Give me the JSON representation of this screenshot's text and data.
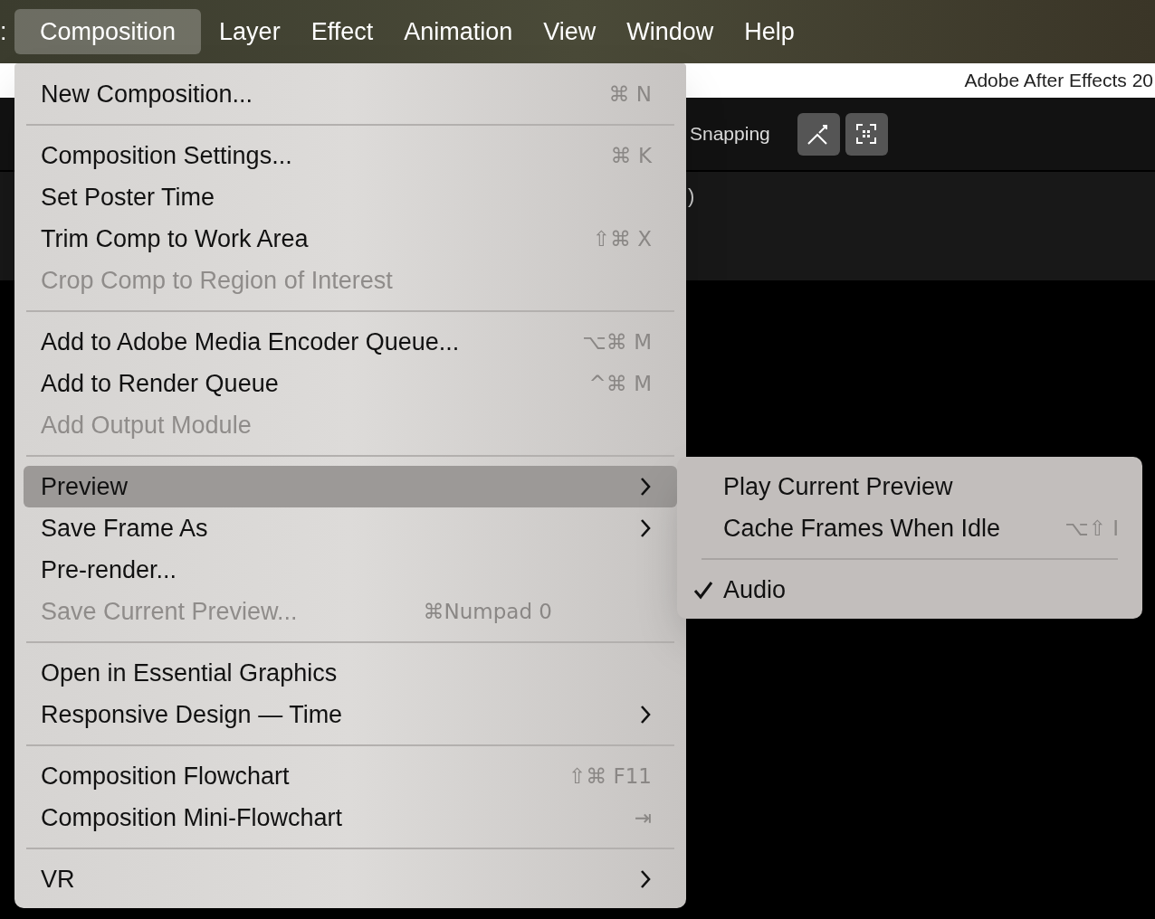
{
  "menubar": {
    "cut_item": ":",
    "items": [
      {
        "label": "Composition",
        "selected": true
      },
      {
        "label": "Layer",
        "selected": false
      },
      {
        "label": "Effect",
        "selected": false
      },
      {
        "label": "Animation",
        "selected": false
      },
      {
        "label": "View",
        "selected": false
      },
      {
        "label": "Window",
        "selected": false
      },
      {
        "label": "Help",
        "selected": false
      }
    ]
  },
  "app_window": {
    "title": "Adobe After Effects 20",
    "toolbar": {
      "snapping_label": "Snapping"
    },
    "panel_text": ")"
  },
  "menu": {
    "items": [
      {
        "kind": "item",
        "label": "New Composition...",
        "shortcut": "⌘ N",
        "disabled": false,
        "submenu": false,
        "selected": false
      },
      {
        "kind": "separator"
      },
      {
        "kind": "item",
        "label": "Composition Settings...",
        "shortcut": "⌘ K",
        "disabled": false,
        "submenu": false,
        "selected": false
      },
      {
        "kind": "item",
        "label": "Set Poster Time",
        "disabled": false,
        "submenu": false,
        "selected": false
      },
      {
        "kind": "item",
        "label": "Trim Comp to Work Area",
        "shortcut": "⇧⌘ X",
        "disabled": false,
        "submenu": false,
        "selected": false
      },
      {
        "kind": "item",
        "label": "Crop Comp to Region of Interest",
        "disabled": true,
        "submenu": false,
        "selected": false
      },
      {
        "kind": "separator"
      },
      {
        "kind": "item",
        "label": "Add to Adobe Media Encoder Queue...",
        "shortcut": "⌥⌘ M",
        "disabled": false,
        "submenu": false,
        "selected": false
      },
      {
        "kind": "item",
        "label": "Add to Render Queue",
        "shortcut": "^⌘ M",
        "disabled": false,
        "submenu": false,
        "selected": false
      },
      {
        "kind": "item",
        "label": "Add Output Module",
        "disabled": true,
        "submenu": false,
        "selected": false
      },
      {
        "kind": "separator"
      },
      {
        "kind": "item",
        "label": "Preview",
        "disabled": false,
        "submenu": true,
        "selected": true
      },
      {
        "kind": "item",
        "label": "Save Frame As",
        "disabled": false,
        "submenu": true,
        "selected": false
      },
      {
        "kind": "item",
        "label": "Pre-render...",
        "disabled": false,
        "submenu": false,
        "selected": false
      },
      {
        "kind": "item",
        "label": "Save Current Preview...",
        "shortcut": "⌘Numpad 0",
        "disabled": true,
        "submenu": false,
        "selected": false
      },
      {
        "kind": "separator"
      },
      {
        "kind": "item",
        "label": "Open in Essential Graphics",
        "disabled": false,
        "submenu": false,
        "selected": false
      },
      {
        "kind": "item",
        "label": "Responsive Design — Time",
        "disabled": false,
        "submenu": true,
        "selected": false
      },
      {
        "kind": "separator"
      },
      {
        "kind": "item",
        "label": "Composition Flowchart",
        "shortcut": "⇧⌘ F11",
        "disabled": false,
        "submenu": false,
        "selected": false
      },
      {
        "kind": "item",
        "label": "Composition Mini-Flowchart",
        "shortcut": "⇥",
        "disabled": false,
        "submenu": false,
        "selected": false
      },
      {
        "kind": "separator"
      },
      {
        "kind": "item",
        "label": "VR",
        "disabled": false,
        "submenu": true,
        "selected": false
      }
    ]
  },
  "submenu": {
    "items": [
      {
        "kind": "item",
        "label": "Play Current Preview",
        "checked": false
      },
      {
        "kind": "item",
        "label": "Cache Frames When Idle",
        "shortcut": "⌥⇧ I",
        "checked": false
      },
      {
        "kind": "separator"
      },
      {
        "kind": "item",
        "label": "Audio",
        "checked": true
      }
    ]
  }
}
